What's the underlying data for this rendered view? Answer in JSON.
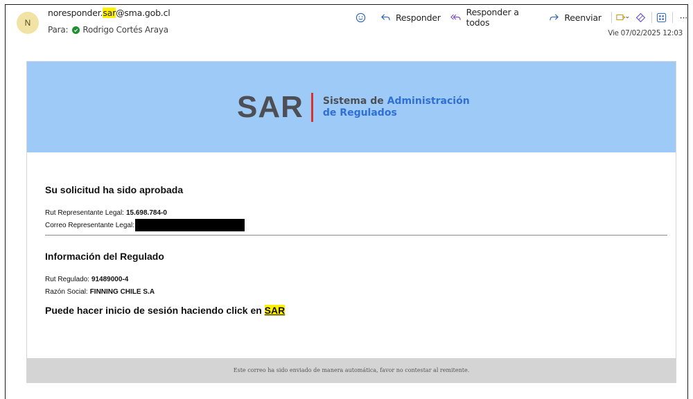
{
  "header": {
    "avatar_initial": "N",
    "sender_prefix": "noresponder.",
    "sender_highlight": "sar",
    "sender_suffix": "@sma.gob.cl",
    "to_label": "Para:",
    "recipient": "Rodrigo Cortés Araya",
    "date": "Vie 07/02/2025 12:03"
  },
  "toolbar": {
    "reply": "Responder",
    "reply_all": "Responder a todos",
    "forward": "Reenviar",
    "more": "···"
  },
  "logo": {
    "mark": "SAR",
    "line1_a": "Sistema de ",
    "line1_b": "Administración",
    "line2": "de Regulados"
  },
  "body": {
    "title": "Su solicitud ha sido aprobada",
    "rut_rep_label": "Rut Representante Legal:",
    "rut_rep_value": "15.698.784-0",
    "email_rep_label": "Correo Representante Legal:",
    "section2_title": "Información del Regulado",
    "rut_reg_label": "Rut Regulado:",
    "rut_reg_value": "91489000-4",
    "razon_label": "Razón Social:",
    "razon_value": "FINNING CHILE S.A",
    "cta_text": "Puede hacer inicio de sesión haciendo click en",
    "cta_link": "SAR",
    "footer": "Este correo ha sido enviado de manera automática, favor no contestar al remitente."
  },
  "colors": {
    "banner": "#9dcaf7",
    "highlight": "#fff100",
    "logo_red": "#d9312b",
    "logo_blue": "#2f6fd6"
  }
}
